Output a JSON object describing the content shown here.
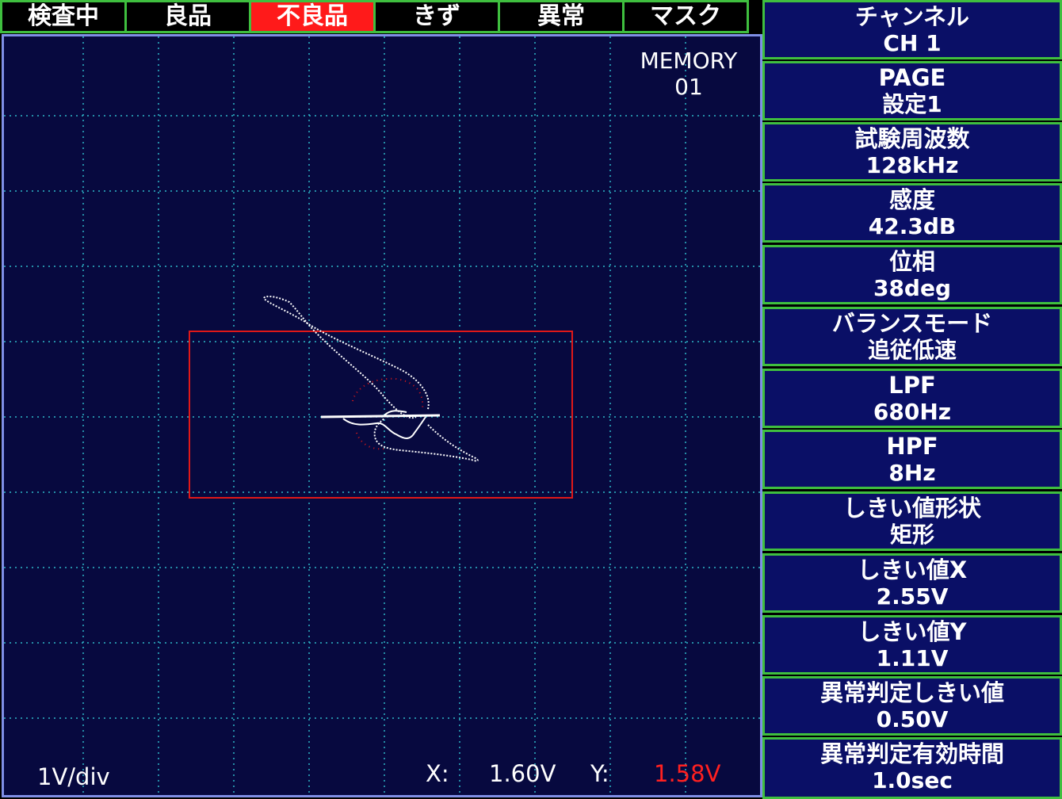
{
  "status_tabs": [
    {
      "label": "検査中",
      "active": false
    },
    {
      "label": "良品",
      "active": false
    },
    {
      "label": "不良品",
      "active": true
    },
    {
      "label": "きず",
      "active": false
    },
    {
      "label": "異常",
      "active": false
    },
    {
      "label": "マスク",
      "active": false
    }
  ],
  "scope": {
    "memory_label": "MEMORY\n01",
    "scale": "1V/div",
    "x_label": "X:",
    "x_value": "1.60V",
    "y_label": "Y:",
    "y_value": "1.58V",
    "colors": {
      "background": "#07093f",
      "grid": "#2fb7c8",
      "threshold_box": "#e01818",
      "signal": "#ffffff",
      "y_value": "#ff2020"
    }
  },
  "params": [
    {
      "label": "チャンネル",
      "value": "CH 1"
    },
    {
      "label": "PAGE",
      "value": "設定1"
    },
    {
      "label": "試験周波数",
      "value": "128kHz"
    },
    {
      "label": "感度",
      "value": "42.3dB"
    },
    {
      "label": "位相",
      "value": "38deg"
    },
    {
      "label": "バランスモード",
      "value": "追従低速"
    },
    {
      "label": "LPF",
      "value": "680Hz"
    },
    {
      "label": "HPF",
      "value": "8Hz"
    },
    {
      "label": "しきい値形状",
      "value": "矩形"
    },
    {
      "label": "しきい値X",
      "value": "2.55V"
    },
    {
      "label": "しきい値Y",
      "value": "1.11V"
    },
    {
      "label": "異常判定しきい値",
      "value": "0.50V"
    },
    {
      "label": "異常判定有効時間",
      "value": "1.0sec"
    }
  ]
}
